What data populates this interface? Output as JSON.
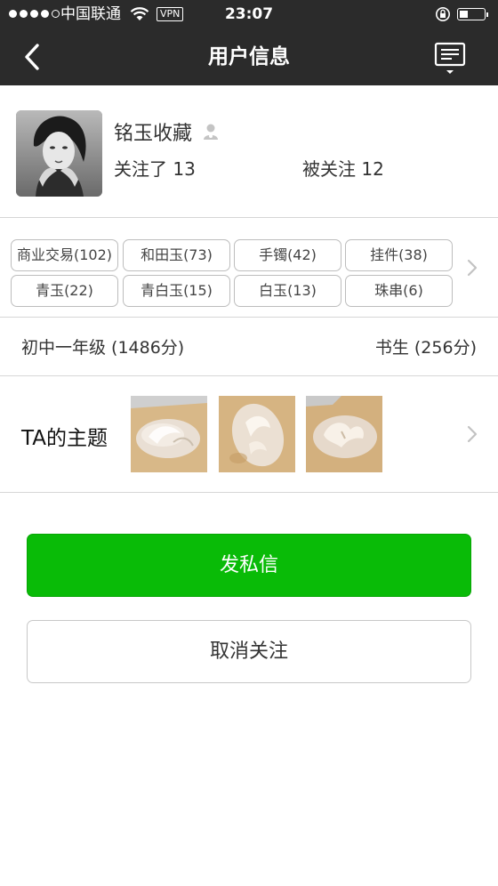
{
  "status_bar": {
    "carrier": "中国联通",
    "vpn": "VPN",
    "time": "23:07"
  },
  "nav": {
    "title": "用户信息",
    "back_icon": "chevron-left-icon",
    "menu_icon": "message-list-icon"
  },
  "profile": {
    "username": "铭玉收藏",
    "following": "关注了 13",
    "followers": "被关注 12",
    "badge_icon": "user-badge-icon"
  },
  "tags": [
    "商业交易(102)",
    "和田玉(73)",
    "手镯(42)",
    "挂件(38)",
    "青玉(22)",
    "青白玉(15)",
    "白玉(13)",
    "珠串(6)"
  ],
  "level": {
    "primary": "初中一年级 (1486分)",
    "secondary": "书生 (256分)"
  },
  "topics": {
    "label": "TA的主题",
    "thumb_count": 3
  },
  "actions": {
    "message": "发私信",
    "unfollow": "取消关注"
  },
  "colors": {
    "nav_bg": "#2b2b2b",
    "primary_green": "#09bb07",
    "divider": "#d6d6d6"
  }
}
